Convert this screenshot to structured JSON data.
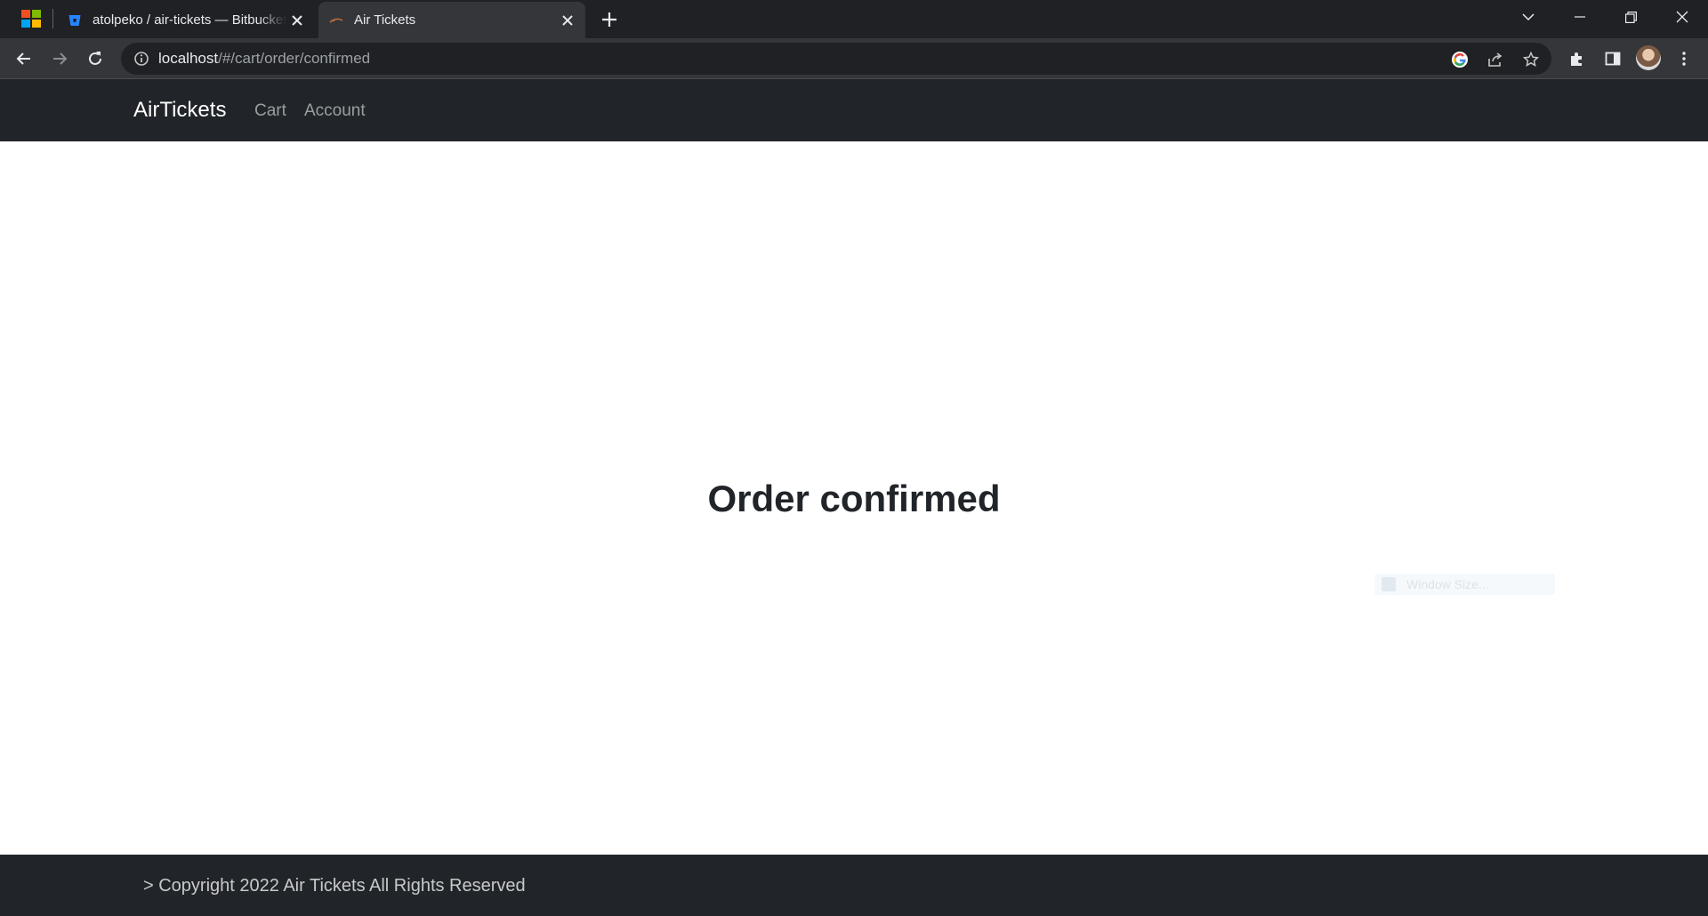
{
  "browser": {
    "tabs": [
      {
        "title": "atolpeko / air-tickets — Bitbucket",
        "favicon": "bitbucket-icon",
        "active": false
      },
      {
        "title": "Air Tickets",
        "favicon": "site-favicon-icon",
        "active": true
      }
    ],
    "address": {
      "host": "localhost",
      "path": "/#/cart/order/confirmed"
    }
  },
  "navbar": {
    "brand": "AirTickets",
    "links": [
      "Cart",
      "Account"
    ]
  },
  "main": {
    "title": "Order confirmed",
    "ghost_overlay_label": "Window Size..."
  },
  "footer": {
    "copyright": "> Copyright 2022 Air Tickets All Rights Reserved"
  },
  "colors": {
    "chrome_dark": "#202124",
    "chrome_toolbar": "#35363a",
    "navbar_bg": "#212529",
    "title_text": "#212529"
  }
}
